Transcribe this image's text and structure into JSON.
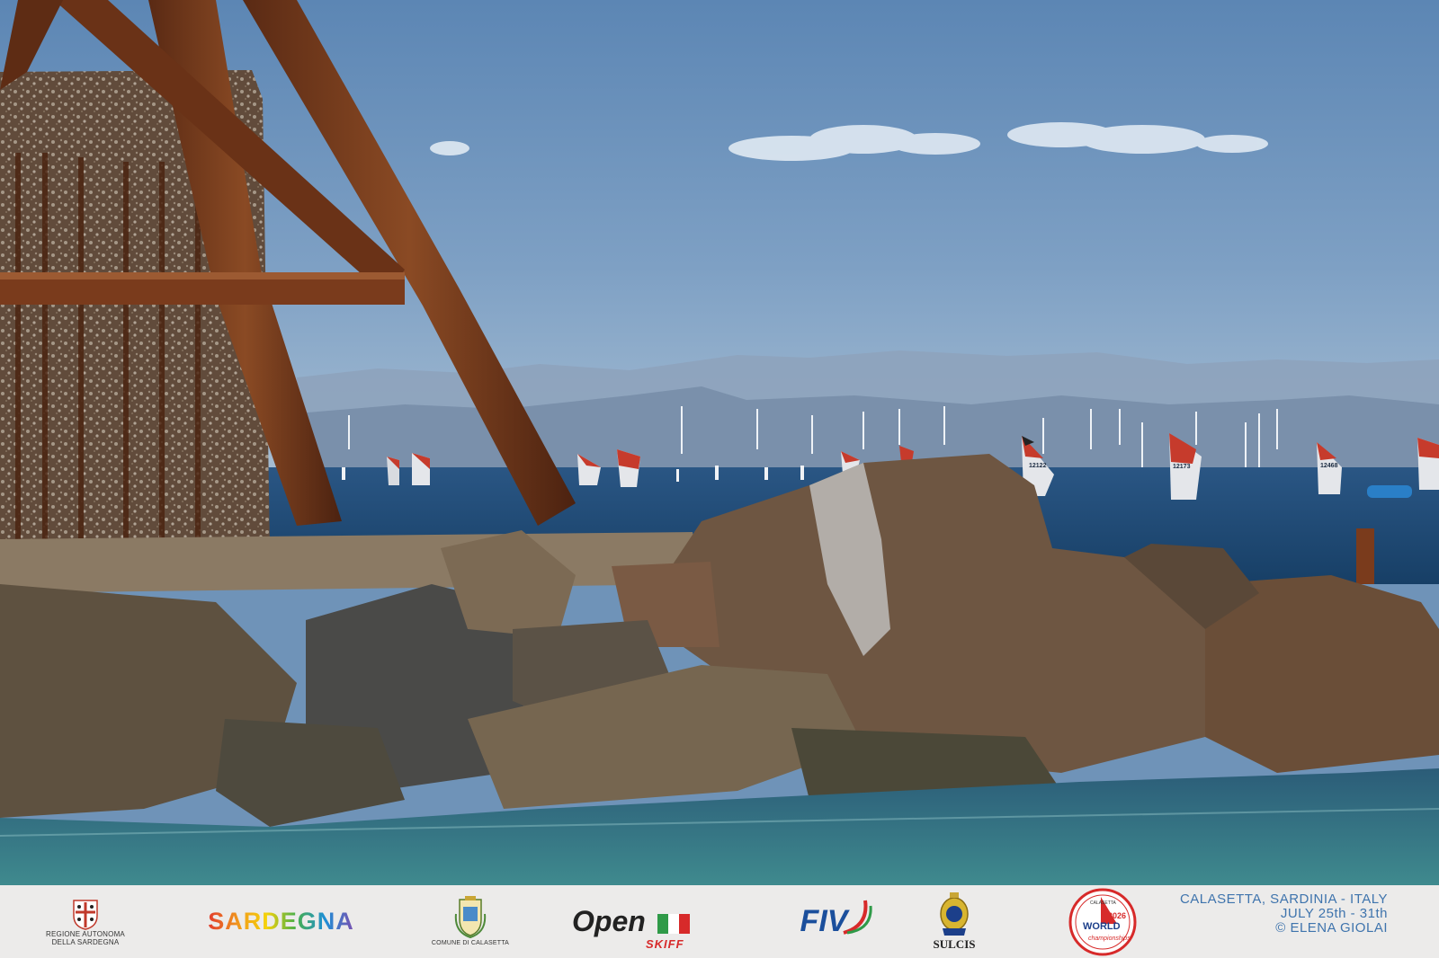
{
  "photo": {
    "subject": "rusted-steel-pylon-rocks-and-windsurf-regatta",
    "sail_numbers": [
      "12122",
      "12173",
      "12468"
    ]
  },
  "footer": {
    "logos": {
      "regione": {
        "line1": "REGIONE AUTONOMA",
        "line2": "DELLA SARDEGNA"
      },
      "sardegna": "SARDEGNA",
      "comune": "COMUNE DI CALASETTA",
      "openskiff": {
        "main": "Open",
        "sub": "SKIFF"
      },
      "fiv": "FIV",
      "sulcis": "SULCIS",
      "championship": {
        "top": "CALASETTA",
        "year": "2026",
        "word": "WORLD",
        "sub": "championships"
      }
    },
    "event": {
      "location": "CALASETTA, SARDINIA - ITALY",
      "dates": "JULY  25th - 31th",
      "credit": "© ELENA GIOLAI"
    }
  },
  "colors": {
    "sky": "#6f93b8",
    "sea": "#1f4d7a",
    "rust": "#7a3b1c",
    "event_text": "#3f74ad",
    "footer_bg": "#ecebea"
  }
}
